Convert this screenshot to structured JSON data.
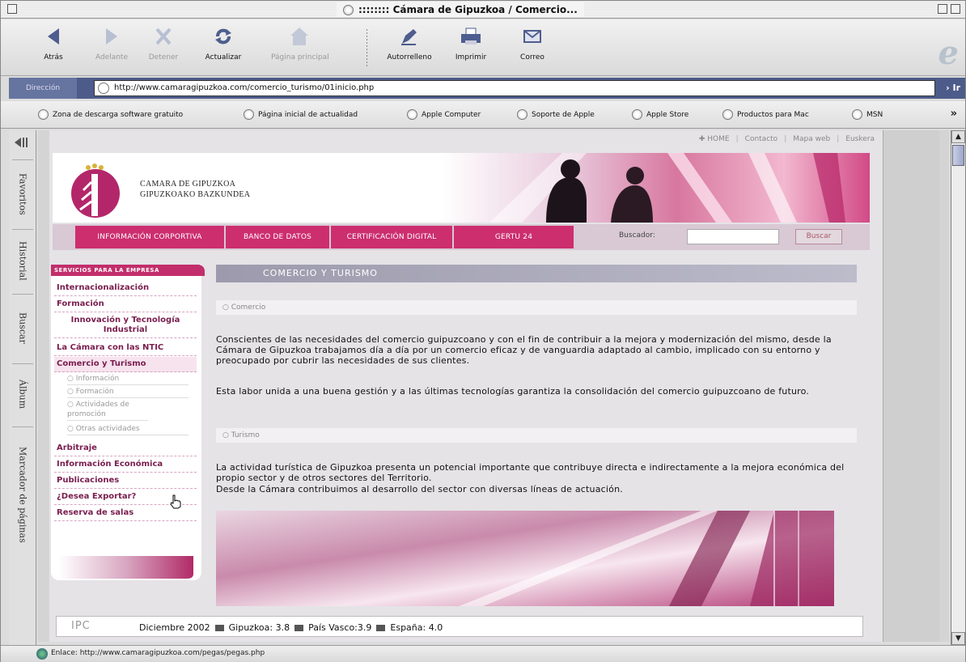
{
  "window": {
    "title": ":::::::: Cámara de Gipuzkoa / Comercio..."
  },
  "toolbar": {
    "back": "Atrás",
    "forward": "Adelante",
    "stop": "Detener",
    "refresh": "Actualizar",
    "home": "Página principal",
    "autofill": "Autorrelleno",
    "print": "Imprimir",
    "mail": "Correo"
  },
  "address": {
    "label": "Dirección",
    "url": "http://www.camaragipuzkoa.com/comercio_turismo/01inicio.php",
    "go": "› Ir"
  },
  "favorites": [
    "Zona de descarga software gratuito",
    "Página inicial de actualidad",
    "Apple Computer",
    "Soporte de Apple",
    "Apple Store",
    "Productos para Mac",
    "MSN"
  ],
  "favorites_more": "»",
  "sidebar_tabs": [
    "Favoritos",
    "Historial",
    "Buscar",
    "Álbum",
    "Marcador de páginas"
  ],
  "site": {
    "top_links": [
      "✚ HOME",
      "Contacto",
      "Mapa web",
      "Euskera"
    ],
    "logo_line1": "CAMARA DE GIPUZKOA",
    "logo_line2": "GIPUZKOAKO BAZKUNDEA",
    "nav": [
      "INFORMACIÓN CORPORTIVA",
      "BANCO DE DATOS",
      "CERTIFICACIÓN DIGITAL",
      "GERTU 24"
    ],
    "search_label": "Buscador:",
    "search_value": "",
    "search_button": "Buscar",
    "menu_header": "SERVICIOS PARA LA EMPRESA",
    "menu": [
      "Internacionalización",
      "Formación",
      "Innovación y Tecnología Industrial",
      "La Cámara con las NTIC",
      "Comercio y Turismo",
      "Arbitraje",
      "Información Económica",
      "Publicaciones",
      "¿Desea Exportar?",
      "Reserva de salas"
    ],
    "submenu": [
      "Información",
      "Formación",
      "Actividades de promoción",
      "Otras actividades"
    ],
    "section_title": "COMERCIO Y TURISMO",
    "sub1": "Comercio",
    "para1": "Conscientes de las necesidades del comercio guipuzcoano y con el fin de contribuir a la mejora y modernización del mismo, desde la Cámara de Gipuzkoa trabajamos día a día por un comercio eficaz y de vanguardia adaptado al cambio, implicado con su entorno y preocupado por cubrir las necesidades de sus clientes.",
    "para1b": "Esta labor unida a una buena gestión y a las últimas tecnologías garantiza la consolidación del comercio guipuzcoano de futuro.",
    "sub2": "Turismo",
    "para2": "La actividad turística de Gipuzkoa presenta un potencial importante que contribuye directa e indirectamente a la mejora económica del propio sector y de otros sectores del Territorio.",
    "para2b": "Desde la Cámara contribuimos al desarrollo del sector con diversas líneas de actuación.",
    "ipc_label": "IPC",
    "ipc_date": "Diciembre 2002",
    "ipc_values": [
      "Gipuzkoa: 3.8",
      "País Vasco:3.9",
      "España: 4.0"
    ]
  },
  "status": {
    "text": "Enlace: http://www.camaragipuzkoa.com/pegas/pegas.php"
  },
  "colors": {
    "brand_magenta": "#cc2e6e",
    "address_bar": "#4d5b8a",
    "section_bar": "#9c9aac"
  }
}
